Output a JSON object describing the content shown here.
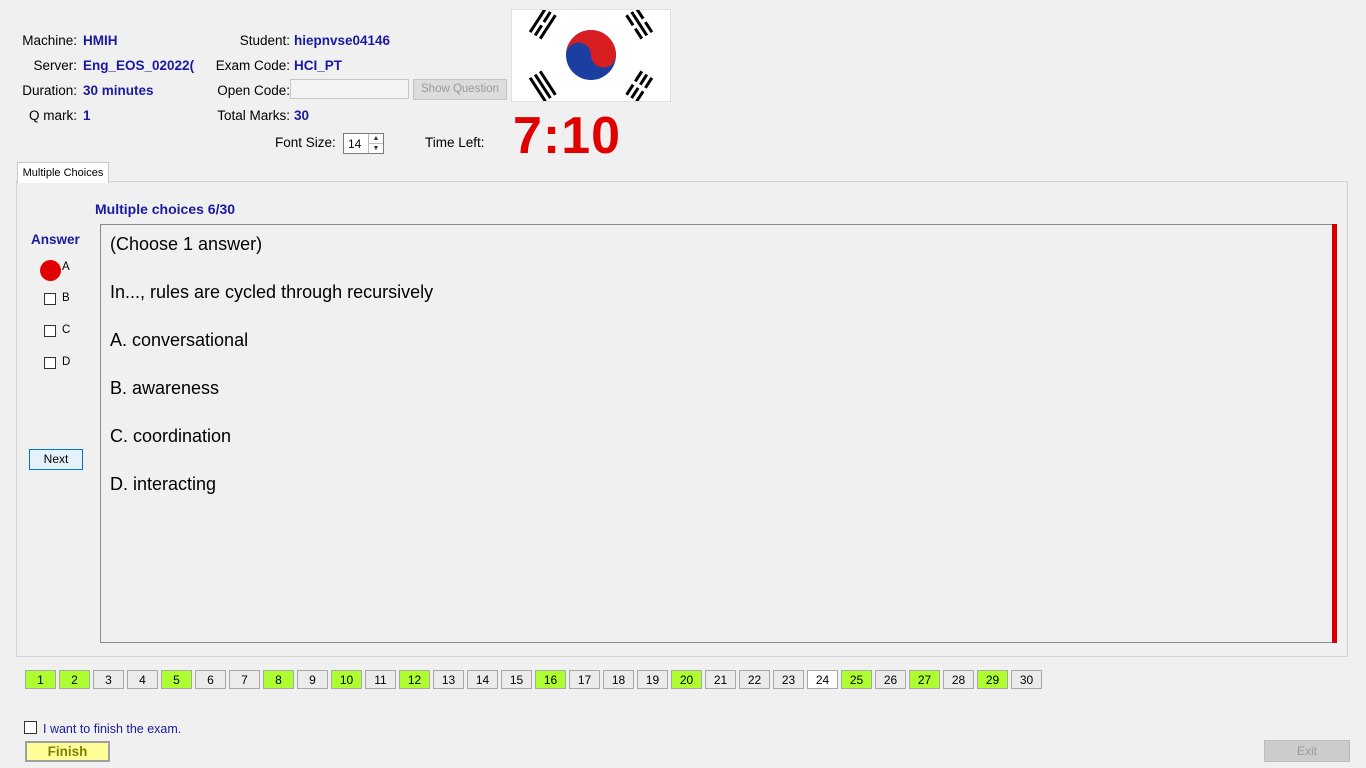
{
  "info": {
    "machine_label": "Machine:",
    "machine_value": "HMIH",
    "server_label": "Server:",
    "server_value": "Eng_EOS_02022(",
    "duration_label": "Duration:",
    "duration_value": "30 minutes",
    "qmark_label": "Q mark:",
    "qmark_value": "1",
    "student_label": "Student:",
    "student_value": "hiepnvse04146",
    "examcode_label": "Exam Code:",
    "examcode_value": "HCI_PT",
    "opencode_label": "Open Code:",
    "opencode_value": "",
    "show_question_label": "Show Question",
    "totalmarks_label": "Total Marks:",
    "totalmarks_value": "30",
    "fontsize_label": "Font Size:",
    "fontsize_value": "14",
    "timeleft_label": "Time Left:",
    "timer": "7:10"
  },
  "tabs": {
    "multiple_choices": "Multiple Choices"
  },
  "question": {
    "title": "Multiple choices 6/30",
    "lines": [
      "(Choose 1 answer)",
      "In..., rules are cycled through recursively",
      "A.  conversational",
      "B.  awareness",
      "C.  coordination",
      "D.  interacting"
    ]
  },
  "answer": {
    "title": "Answer",
    "options": [
      "A",
      "B",
      "C",
      "D"
    ],
    "selected": "A",
    "next_label": "Next"
  },
  "qnumbers": {
    "items": [
      "1",
      "2",
      "3",
      "4",
      "5",
      "6",
      "7",
      "8",
      "9",
      "10",
      "11",
      "12",
      "13",
      "14",
      "15",
      "16",
      "17",
      "18",
      "19",
      "20",
      "21",
      "22",
      "23",
      "24",
      "25",
      "26",
      "27",
      "28",
      "29",
      "30"
    ],
    "answered": [
      1,
      2,
      5,
      8,
      10,
      12,
      16,
      20,
      25,
      27,
      29
    ],
    "current": 24
  },
  "footer": {
    "finish_check_label": "I want to finish the exam.",
    "finish_label": "Finish",
    "exit_label": "Exit"
  },
  "colors": {
    "accent_blue": "#1a1aa0",
    "timer_red": "#e00000",
    "answered_green": "#adff2f"
  }
}
